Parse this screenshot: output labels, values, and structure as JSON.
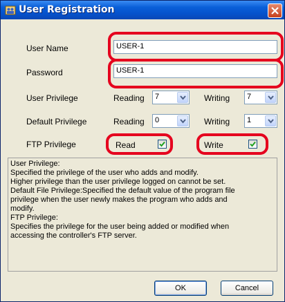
{
  "window": {
    "title": "User Registration"
  },
  "form": {
    "user_name": {
      "label": "User Name",
      "value": "USER-1"
    },
    "password": {
      "label": "Password",
      "value": "USER-1"
    },
    "user_privilege": {
      "label": "User Privilege",
      "reading_label": "Reading",
      "reading_value": "7",
      "writing_label": "Writing",
      "writing_value": "7"
    },
    "default_privilege": {
      "label": "Default Privilege",
      "reading_label": "Reading",
      "reading_value": "0",
      "writing_label": "Writing",
      "writing_value": "1"
    },
    "ftp_privilege": {
      "label": "FTP Privilege",
      "read_label": "Read",
      "read_checked": true,
      "write_label": "Write",
      "write_checked": true
    }
  },
  "description": [
    "User Privilege:",
    "Specified the privilege of the user who adds and modify.",
    "Higher privilege than the user privilege logged on cannot be set.",
    "Default File Privilege:Specified the default value of the program file",
    "privilege when the user newly makes the program who adds and",
    "modify.",
    "FTP Privilege:",
    "Specifies the privilege for the user being added or modified when",
    "accessing the controller's FTP server."
  ],
  "buttons": {
    "ok": "OK",
    "cancel": "Cancel"
  },
  "colors": {
    "highlight": "#E5001E",
    "title_bar": "#0552CC"
  },
  "icons": {
    "title": "users-icon",
    "close": "close-icon",
    "dropdown": "chevron-down-icon",
    "check": "checkmark-icon"
  }
}
